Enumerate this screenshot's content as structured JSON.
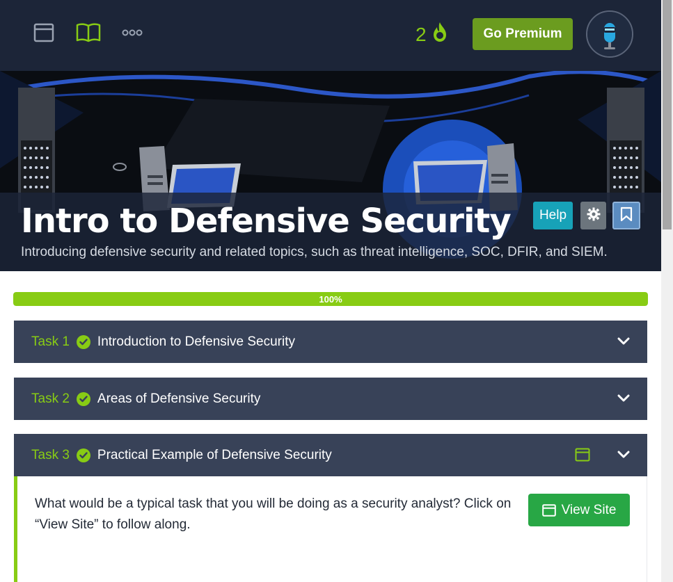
{
  "nav": {
    "icons": [
      "browser-window-icon",
      "book-icon",
      "more-dots-icon"
    ],
    "streak_count": "2",
    "premium_label": "Go Premium"
  },
  "room": {
    "title": "Intro to Defensive Security",
    "description": "Introducing defensive security and related topics, such as threat intelligence, SOC, DFIR, and SIEM.",
    "help_label": "Help"
  },
  "progress": {
    "value": 100,
    "label": "100%"
  },
  "tasks": [
    {
      "number": "Task 1",
      "title": "Introduction to Defensive Security",
      "completed": true,
      "expanded": false
    },
    {
      "number": "Task 2",
      "title": "Areas of Defensive Security",
      "completed": true,
      "expanded": false
    },
    {
      "number": "Task 3",
      "title": "Practical Example of Defensive Security",
      "completed": true,
      "expanded": true
    }
  ],
  "task3_body": {
    "text": "What would be a typical task that you will be doing as a security analyst? Click on “View Site” to follow along.",
    "view_site_label": "View Site"
  },
  "colors": {
    "nav_bg": "#1c2538",
    "accent_green": "#88cc14",
    "task_header_bg": "#384258",
    "premium_green": "#6b9c1f",
    "view_site_green": "#28a745",
    "help_teal": "#17a2b8"
  }
}
